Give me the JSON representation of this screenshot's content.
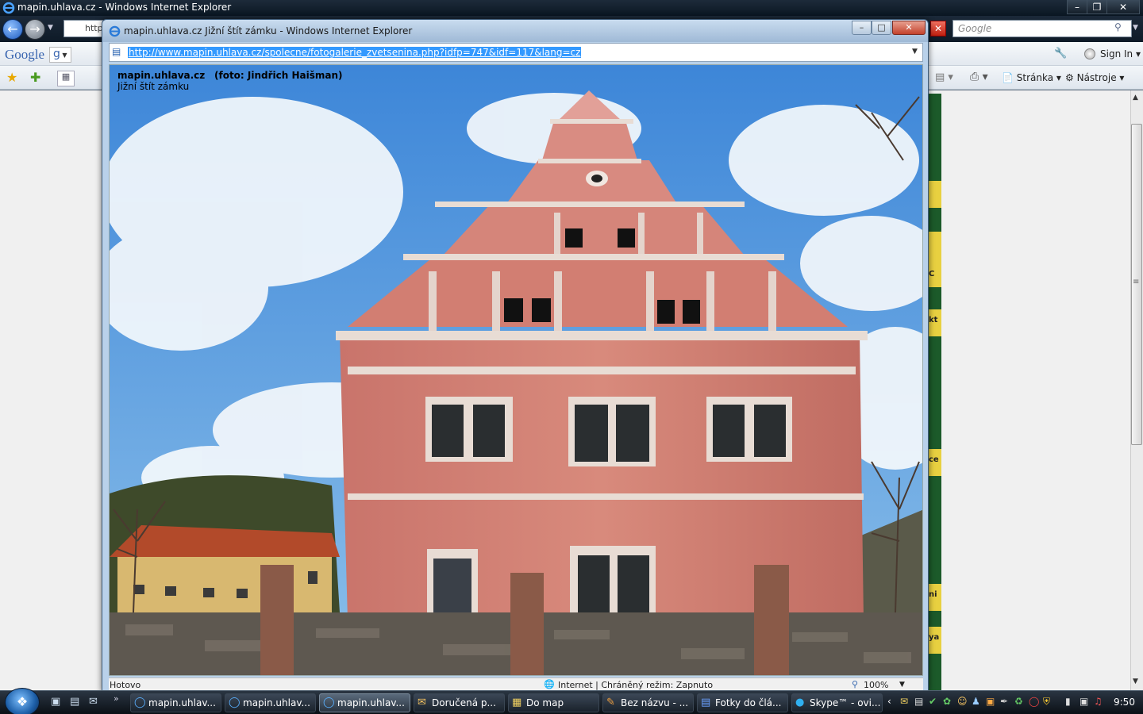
{
  "main_window": {
    "title": "mapin.uhlava.cz - Windows Internet Explorer",
    "address_partial": "http",
    "search_placeholder": "Google",
    "minimize": "–",
    "maximize": "❐",
    "close": "✕"
  },
  "google_toolbar": {
    "logo": "Google",
    "g_button": "g",
    "sign_in": "Sign In"
  },
  "command_bar": {
    "page_menu": "Stránka",
    "tools_menu": "Nástroje"
  },
  "background_strip_fragments": [
    "C",
    "kt",
    "ce",
    "ni",
    "ya"
  ],
  "popup": {
    "title": "mapin.uhlava.cz Jižní štít zámku - Windows Internet Explorer",
    "url": "http://www.mapin.uhlava.cz/spolecne/fotogalerie_zvetsenina.php?idfp=747&idf=117&lang=cz",
    "caption_site": "mapin.uhlava.cz",
    "caption_photo": "(foto: Jindřich Haišman)",
    "caption_title": "Jižní štít zámku",
    "status_text": "Hotovo",
    "status_zone": "Internet | Chráněný režim: Zapnuto",
    "zoom": "100%",
    "minimize": "–",
    "maximize": "□",
    "close": "✕"
  },
  "taskbar": {
    "items": [
      {
        "label": "mapin.uhlav...",
        "icon": "ie-icon"
      },
      {
        "label": "mapin.uhlav...",
        "icon": "ie-icon"
      },
      {
        "label": "mapin.uhlav...",
        "icon": "ie-icon"
      },
      {
        "label": "Doručená p...",
        "icon": "mail-icon"
      },
      {
        "label": "Do map",
        "icon": "folder-icon"
      },
      {
        "label": "Bez názvu - ...",
        "icon": "paint-icon"
      },
      {
        "label": "Fotky do člá...",
        "icon": "word-icon"
      },
      {
        "label": "Skype™ - ovi...",
        "icon": "skype-icon"
      }
    ],
    "clock": "9:50"
  }
}
